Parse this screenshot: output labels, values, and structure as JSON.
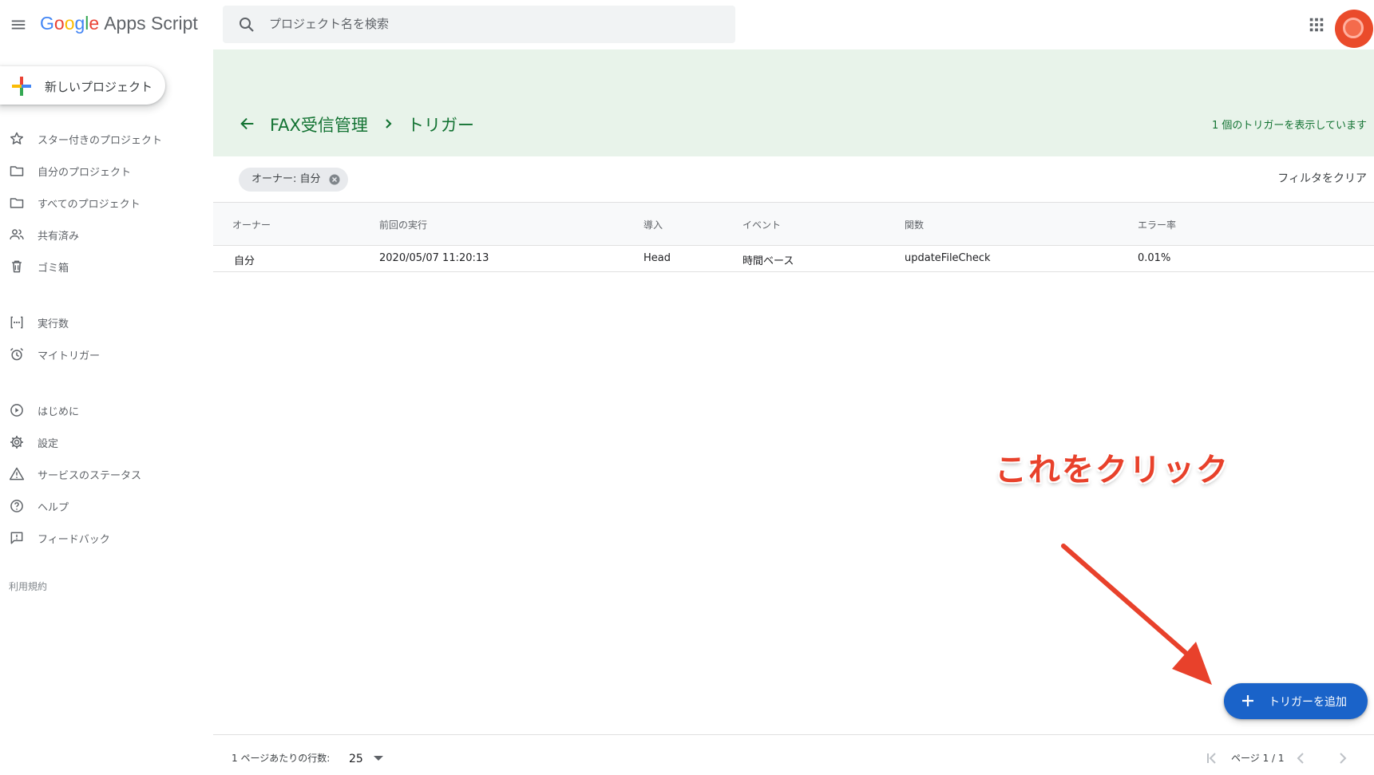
{
  "header": {
    "logo_google": "Google",
    "logo_product": "Apps Script",
    "search_placeholder": "プロジェクト名を検索",
    "menu_icon": "hamburger-menu-icon",
    "apps_icon": "google-apps-grid-icon"
  },
  "sidebar": {
    "new_project_label": "新しいプロジェクト",
    "items": [
      {
        "label": "スター付きのプロジェクト",
        "icon": "star-icon"
      },
      {
        "label": "自分のプロジェクト",
        "icon": "folder-icon"
      },
      {
        "label": "すべてのプロジェクト",
        "icon": "folder-icon"
      },
      {
        "label": "共有済み",
        "icon": "people-icon"
      },
      {
        "label": "ゴミ箱",
        "icon": "trash-icon"
      },
      {
        "label": "実行数",
        "icon": "executions-icon"
      },
      {
        "label": "マイトリガー",
        "icon": "alarm-clock-icon"
      },
      {
        "label": "はじめに",
        "icon": "play-circle-icon"
      },
      {
        "label": "設定",
        "icon": "gear-icon"
      },
      {
        "label": "サービスのステータス",
        "icon": "warning-icon"
      },
      {
        "label": "ヘルプ",
        "icon": "help-icon"
      },
      {
        "label": "フィードバック",
        "icon": "feedback-icon"
      }
    ],
    "terms_label": "利用規約"
  },
  "banner": {
    "project_name": "FAX受信管理",
    "page_title": "トリガー",
    "trigger_count_text": "1 個のトリガーを表示しています",
    "background_color": "#e8f3ea",
    "accent_color": "#137333"
  },
  "filter": {
    "chip_label": "オーナー: 自分",
    "clear_label": "フィルタをクリア"
  },
  "table": {
    "columns": [
      "オーナー",
      "前回の実行",
      "導入",
      "イベント",
      "関数",
      "エラー率"
    ],
    "rows": [
      {
        "owner": "自分",
        "last_run": "2020/05/07 11:20:13",
        "deployment": "Head",
        "event": "時間ベース",
        "function": "updateFileCheck",
        "error_rate": "0.01%"
      }
    ]
  },
  "annotation": {
    "text": "これをクリック",
    "color": "#e8412b"
  },
  "fab": {
    "label": "トリガーを追加",
    "color": "#1a63c9"
  },
  "footer": {
    "rows_per_page_label": "1 ページあたりの行数:",
    "rows_per_page_value": "25",
    "page_label": "ページ 1 / 1"
  }
}
